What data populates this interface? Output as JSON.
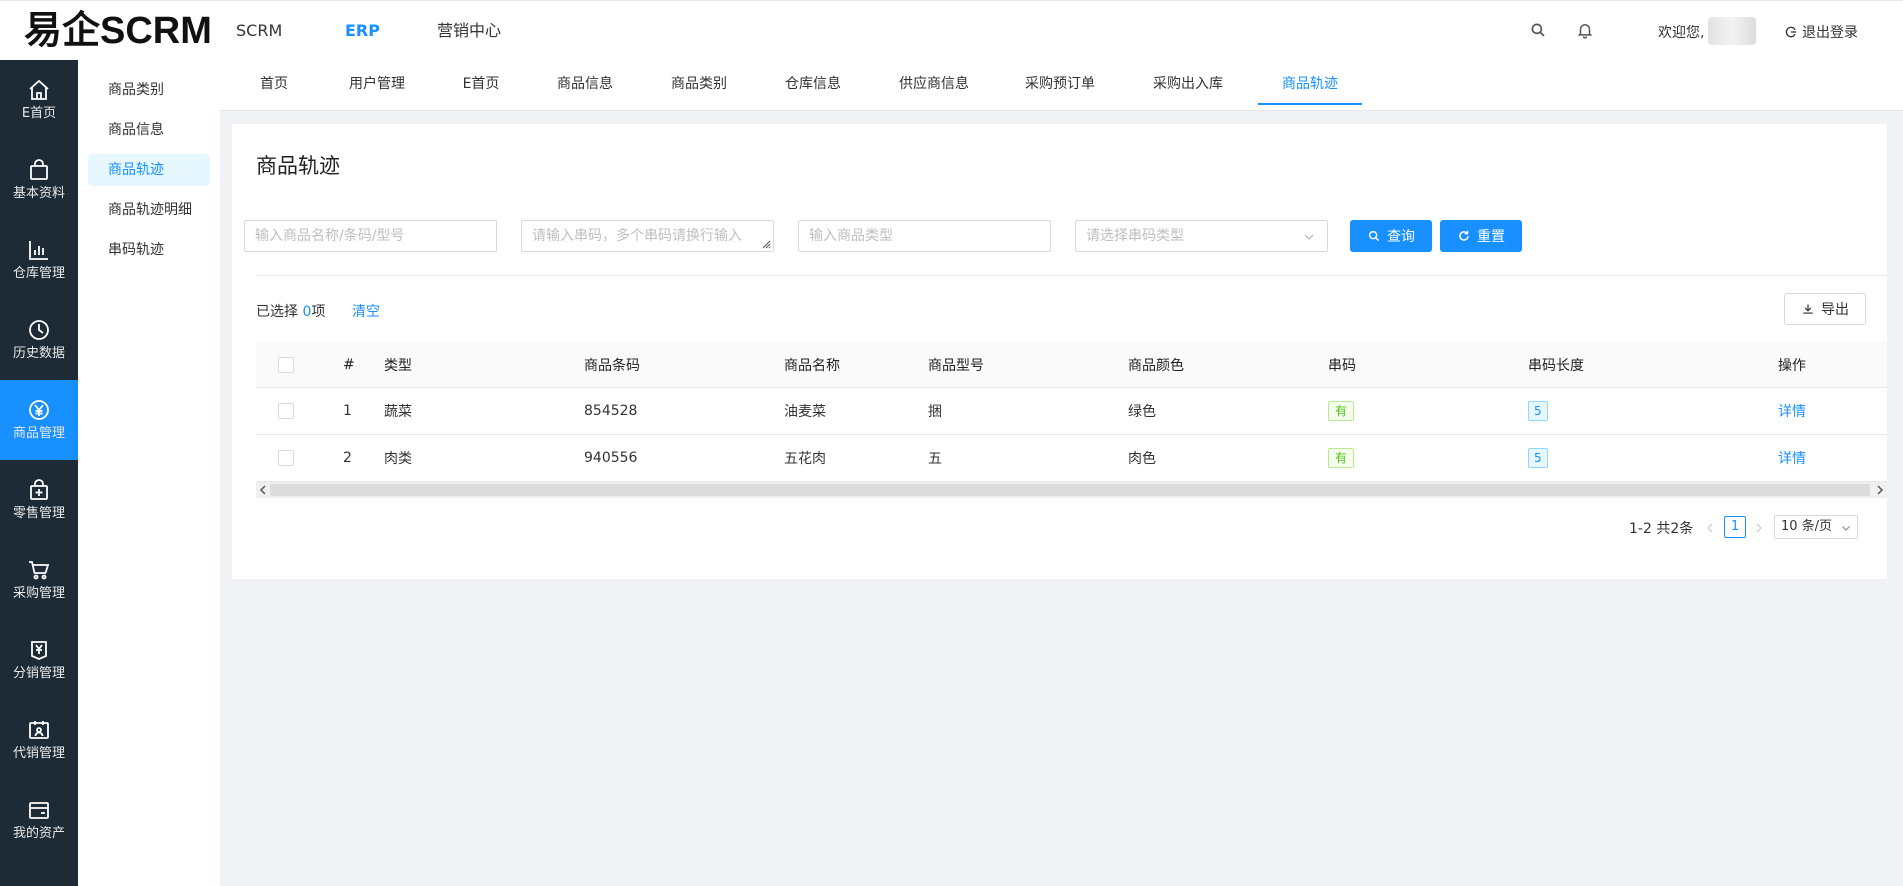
{
  "app": {
    "logo": "易企SCRM"
  },
  "header": {
    "nav": [
      {
        "label": "SCRM",
        "active": false
      },
      {
        "label": "ERP",
        "active": true
      },
      {
        "label": "营销中心",
        "active": false
      }
    ],
    "welcome": "欢迎您,",
    "logout": "退出登录",
    "icons": [
      "search-icon",
      "bell-icon",
      "logout-icon"
    ]
  },
  "sidebar": {
    "items": [
      {
        "label": "E首页",
        "icon": "home-icon",
        "active": false
      },
      {
        "label": "基本资料",
        "icon": "bag-icon",
        "active": false
      },
      {
        "label": "仓库管理",
        "icon": "bar-chart-icon",
        "active": false
      },
      {
        "label": "历史数据",
        "icon": "clock-icon",
        "active": false
      },
      {
        "label": "商品管理",
        "icon": "yen-circle-icon",
        "active": true
      },
      {
        "label": "零售管理",
        "icon": "shop-bag-icon",
        "active": false
      },
      {
        "label": "采购管理",
        "icon": "cart-icon",
        "active": false
      },
      {
        "label": "分销管理",
        "icon": "yen-bag-icon",
        "active": false
      },
      {
        "label": "代销管理",
        "icon": "calendar-user-icon",
        "active": false
      },
      {
        "label": "我的资产",
        "icon": "wallet-icon",
        "active": false
      }
    ]
  },
  "submenu": {
    "items": [
      {
        "label": "商品类别",
        "active": false
      },
      {
        "label": "商品信息",
        "active": false
      },
      {
        "label": "商品轨迹",
        "active": true
      },
      {
        "label": "商品轨迹明细",
        "active": false
      },
      {
        "label": "串码轨迹",
        "active": false
      }
    ]
  },
  "tabs": [
    {
      "label": "首页",
      "active": false
    },
    {
      "label": "用户管理",
      "active": false
    },
    {
      "label": "E首页",
      "active": false
    },
    {
      "label": "商品信息",
      "active": false
    },
    {
      "label": "商品类别",
      "active": false
    },
    {
      "label": "仓库信息",
      "active": false
    },
    {
      "label": "供应商信息",
      "active": false
    },
    {
      "label": "采购预订单",
      "active": false
    },
    {
      "label": "采购出入库",
      "active": false
    },
    {
      "label": "商品轨迹",
      "active": true
    }
  ],
  "page": {
    "title": "商品轨迹",
    "filters": {
      "name_placeholder": "输入商品名称/条码/型号",
      "serial_placeholder": "请输入串码，多个串码请换行输入",
      "category_placeholder": "输入商品类型",
      "serial_type_placeholder": "请选择串码类型"
    },
    "buttons": {
      "query": "查询",
      "reset": "重置",
      "export": "导出"
    },
    "selection": {
      "prefix": "已选择 ",
      "count": "0",
      "suffix": "项",
      "clear": "清空"
    }
  },
  "table": {
    "columns": [
      "#",
      "类型",
      "商品条码",
      "商品名称",
      "商品型号",
      "商品颜色",
      "串码",
      "串码长度",
      "操作"
    ],
    "rows": [
      {
        "index": "1",
        "type": "蔬菜",
        "barcode": "854528",
        "name": "油麦菜",
        "model": "捆",
        "color": "绿色",
        "serial": "有",
        "serial_len": "5",
        "action": "详情"
      },
      {
        "index": "2",
        "type": "肉类",
        "barcode": "940556",
        "name": "五花肉",
        "model": "五",
        "color": "肉色",
        "serial": "有",
        "serial_len": "5",
        "action": "详情"
      }
    ]
  },
  "pagination": {
    "total_text": "1-2 共2条",
    "current": "1",
    "page_size": "10 条/页"
  },
  "colors": {
    "primary": "#1890ff",
    "sidebar_bg": "#1c2b36",
    "success": "#52c41a"
  }
}
